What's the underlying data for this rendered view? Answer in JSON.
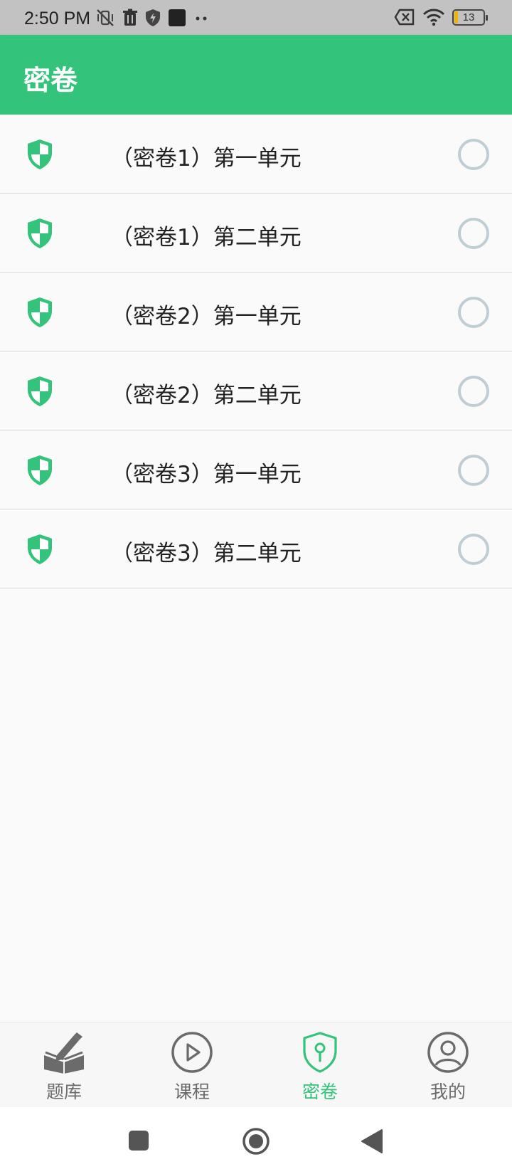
{
  "status_bar": {
    "time": "2:50 PM",
    "battery_level": "13",
    "icons": [
      "vibrate-off-icon",
      "trash-icon",
      "shield-bolt-icon",
      "app-square-icon",
      "more-dots-icon",
      "sim-x-icon",
      "wifi-icon",
      "battery-icon"
    ]
  },
  "app_bar": {
    "title": "密卷"
  },
  "papers": [
    {
      "title": "（密卷1）第一单元",
      "selected": false
    },
    {
      "title": "（密卷1）第二单元",
      "selected": false
    },
    {
      "title": "（密卷2）第一单元",
      "selected": false
    },
    {
      "title": "（密卷2）第二单元",
      "selected": false
    },
    {
      "title": "（密卷3）第一单元",
      "selected": false
    },
    {
      "title": "（密卷3）第二单元",
      "selected": false
    }
  ],
  "bottom_nav": {
    "items": [
      {
        "label": "题库",
        "icon": "book-pencil-icon",
        "active": false
      },
      {
        "label": "课程",
        "icon": "play-circle-icon",
        "active": false
      },
      {
        "label": "密卷",
        "icon": "shield-key-icon",
        "active": true
      },
      {
        "label": "我的",
        "icon": "user-circle-icon",
        "active": false
      }
    ]
  },
  "colors": {
    "accent": "#33c37b",
    "radio_border": "#c1cdd4",
    "inactive_nav": "#6b6b6b"
  }
}
